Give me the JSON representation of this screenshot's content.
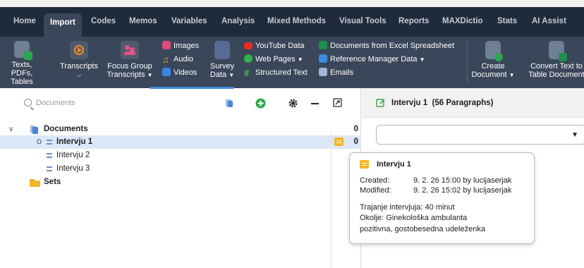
{
  "menu": {
    "tabs": [
      "Home",
      "Import",
      "Codes",
      "Memos",
      "Variables",
      "Analysis",
      "Mixed Methods",
      "Visual Tools",
      "Reports",
      "MAXDictio",
      "Stats",
      "AI Assist"
    ],
    "active": "Import"
  },
  "ribbon": {
    "texts_label_1": "Texts, PDFs,",
    "texts_label_2": "Tables",
    "transcripts_label": "Transcripts",
    "focus_label_1": "Focus Group",
    "focus_label_2": "Transcripts",
    "images_label": "Images",
    "audio_label": "Audio",
    "videos_label": "Videos",
    "survey_label_1": "Survey",
    "survey_label_2": "Data",
    "youtube_label": "YouTube Data",
    "webpages_label": "Web Pages",
    "structured_label": "Structured Text",
    "excel_label": "Documents from Excel Spreadsheet",
    "refmanager_label": "Reference Manager Data",
    "emails_label": "Emails",
    "create_label_1": "Create",
    "create_label_2": "Document",
    "convert_label_1": "Convert Text to",
    "convert_label_2": "Table Document"
  },
  "left": {
    "search_placeholder": "Documents",
    "tree": {
      "root_label": "Documents",
      "root_count": "0",
      "docs": [
        {
          "label": "Intervju 1",
          "count": "0",
          "selected": true
        },
        {
          "label": "Intervju 2"
        },
        {
          "label": "Intervju 3"
        }
      ],
      "sets_label": "Sets",
      "row_marker": "O"
    }
  },
  "right": {
    "title": "Intervju 1",
    "paragraphs": "(56 Paragraphs)"
  },
  "tooltip": {
    "title": "Intervju 1",
    "created_label": "Created:",
    "created_value": "9. 2. 26 15:00 by lucijaserjak",
    "modified_label": "Modified:",
    "modified_value": "9. 2. 26 15:02 by lucijaserjak",
    "memo_line_1": "Trajanje intervjuja: 40 minut",
    "memo_line_2": "Okolje: Ginekološka ambulanta",
    "memo_line_3": "pozitivna, gostobesedna udeleženka"
  },
  "colors": {
    "menu_bg": "#1f2a3a",
    "ribbon_bg": "#3a4659",
    "selection": "#dce8f8",
    "accent": "#3d8bd8",
    "memo": "#f2b824",
    "add_green": "#2aa84a"
  }
}
